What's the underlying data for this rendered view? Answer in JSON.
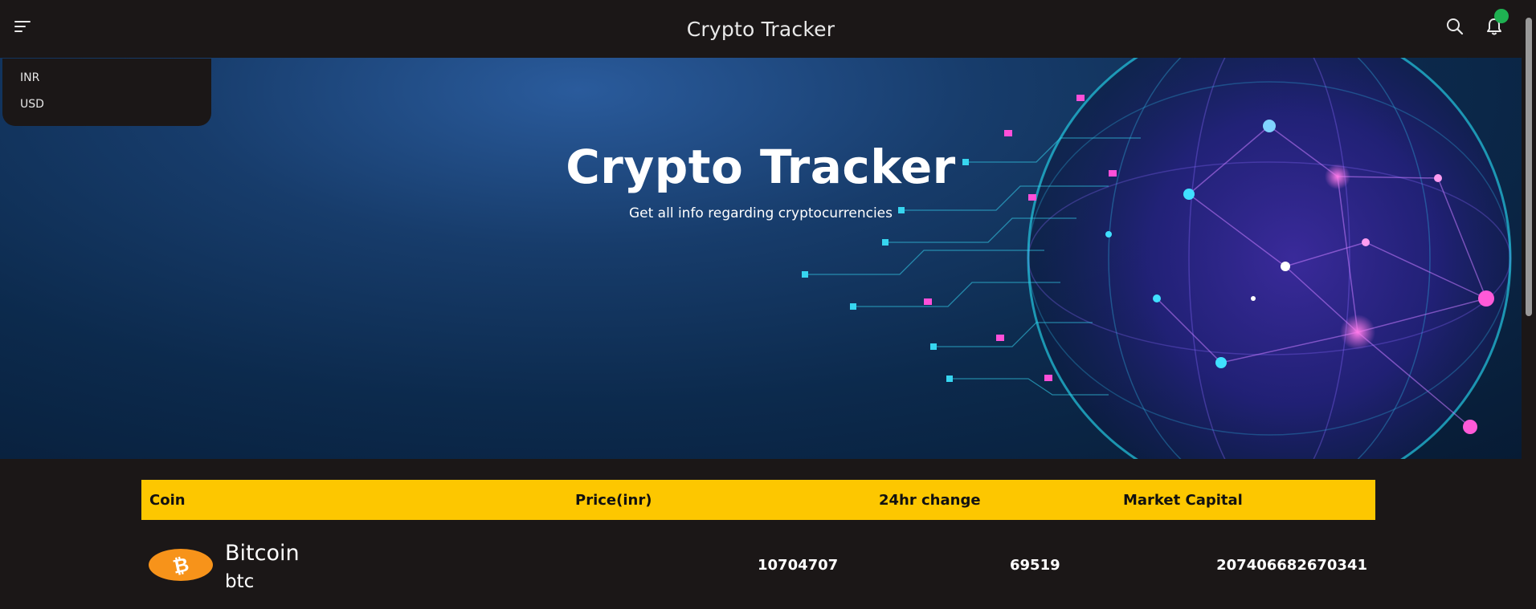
{
  "header": {
    "title": "Crypto Tracker",
    "menu_icon": "menu-icon",
    "search_icon": "search-icon",
    "notification_icon": "bell-icon",
    "notification_dot_color": "#1fb152"
  },
  "currency_menu": {
    "options": [
      "INR",
      "USD"
    ]
  },
  "hero": {
    "title": "Crypto Tracker",
    "subtitle": "Get all info regarding cryptocurrencies"
  },
  "table": {
    "header_color": "#fdc700",
    "columns": [
      "Coin",
      "Price(inr)",
      "24hr change",
      "Market Capital"
    ],
    "rows": [
      {
        "name": "Bitcoin",
        "symbol": "btc",
        "icon": "bitcoin-icon",
        "price": "10704707",
        "change": "69519",
        "market_cap": "207406682670341"
      }
    ]
  }
}
